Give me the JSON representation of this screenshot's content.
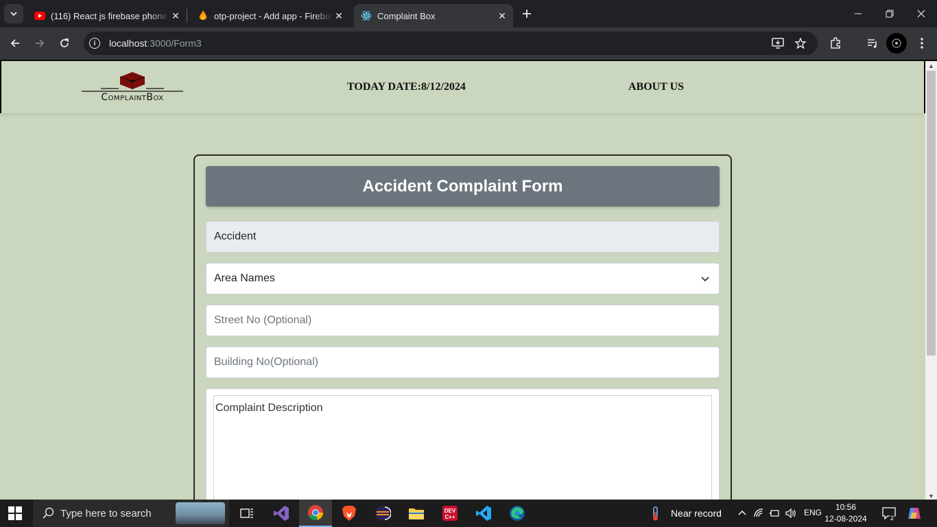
{
  "browser": {
    "tabs": [
      {
        "title": "(116) React js firebase phone au",
        "favicon": "youtube-icon",
        "active": false
      },
      {
        "title": "otp-project - Add app - Firebas",
        "favicon": "firebase-icon",
        "active": false
      },
      {
        "title": "Complaint Box",
        "favicon": "react-icon",
        "active": true
      }
    ],
    "url_host": "localhost",
    "url_path": ":3000/Form3"
  },
  "navbar": {
    "logo_text": "ComplaintBox",
    "date_label": "TODAY DATE:8/12/2024",
    "about_label": "ABOUT US"
  },
  "form": {
    "title": "Accident Complaint Form",
    "complaint_type_value": "Accident",
    "area_select_value": "Area Names",
    "street_placeholder": "Street No (Optional)",
    "building_placeholder": "Building No(Optional)",
    "description_placeholder": "Complaint Description"
  },
  "taskbar": {
    "search_placeholder": "Type here to search",
    "weather_text": "Near record",
    "language": "ENG",
    "time": "10:56",
    "date": "12-08-2024",
    "notification_count": "2"
  },
  "colors": {
    "page_bg": "#cad6bd",
    "form_header_bg": "#6c757d",
    "logo_accent": "#7a0d0d"
  }
}
